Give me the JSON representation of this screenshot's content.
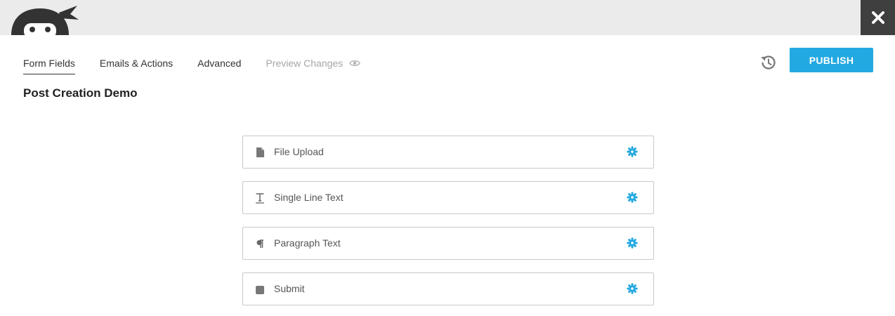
{
  "tabs": [
    {
      "label": "Form Fields"
    },
    {
      "label": "Emails & Actions"
    },
    {
      "label": "Advanced"
    },
    {
      "label": "Preview Changes"
    }
  ],
  "header": {
    "publish_label": "PUBLISH",
    "form_title": "Post Creation Demo"
  },
  "fields": [
    {
      "label": "File Upload",
      "icon": "file-icon"
    },
    {
      "label": "Single Line Text",
      "icon": "text-icon"
    },
    {
      "label": "Paragraph Text",
      "icon": "paragraph-icon"
    },
    {
      "label": "Submit",
      "icon": "square-icon"
    }
  ],
  "colors": {
    "accent": "#23a9e1",
    "topbar": "#ebebeb",
    "close_bg": "#3f3f3f",
    "disabled_text": "#a6a6a6"
  }
}
